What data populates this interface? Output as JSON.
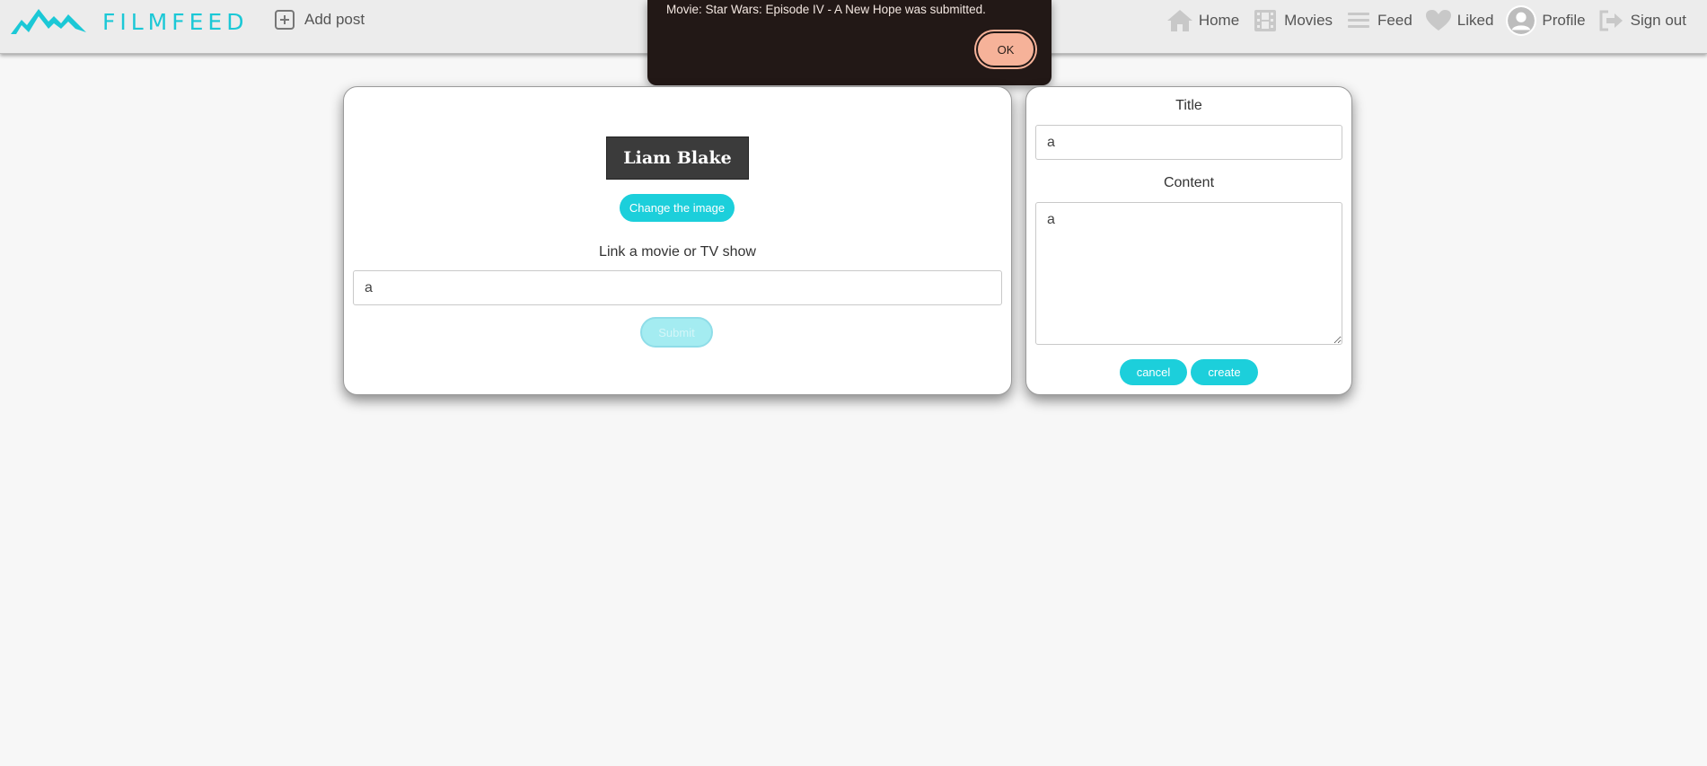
{
  "brand": {
    "name": "FILMFEED",
    "color": "#1bc8d6"
  },
  "header": {
    "add_post_label": "Add post",
    "nav": [
      {
        "label": "Home",
        "icon": "home-icon"
      },
      {
        "label": "Movies",
        "icon": "film-icon"
      },
      {
        "label": "Feed",
        "icon": "feed-icon"
      },
      {
        "label": "Liked",
        "icon": "heart-icon"
      },
      {
        "label": "Profile",
        "icon": "avatar"
      },
      {
        "label": "Sign out",
        "icon": "sign-out-icon"
      }
    ]
  },
  "alert": {
    "message": "Movie: Star Wars: Episode IV - A New Hope was submitted.",
    "ok_label": "OK"
  },
  "left_card": {
    "name": "Liam Blake",
    "change_image_label": "Change the image",
    "link_label": "Link a movie or TV show",
    "link_value": "a",
    "submit_label": "Submit"
  },
  "right_card": {
    "title_label": "Title",
    "title_value": "a",
    "content_label": "Content",
    "content_value": "a",
    "cancel_label": "cancel",
    "create_label": "create"
  }
}
